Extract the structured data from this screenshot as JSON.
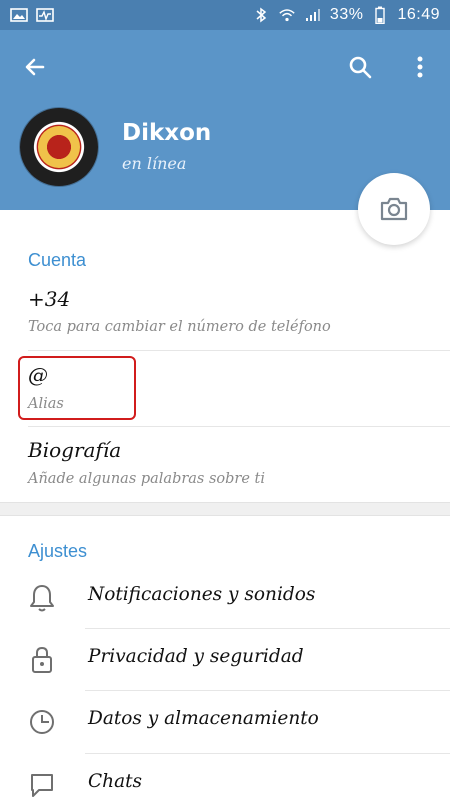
{
  "status_bar": {
    "battery_percent": "33%",
    "time": "16:49"
  },
  "profile": {
    "name": "Dikxon",
    "status": "en línea"
  },
  "account": {
    "section_title": "Cuenta",
    "phone_value": "+34",
    "phone_hint": "Toca para cambiar el número de teléfono",
    "username_value": "@",
    "username_hint": "Alias",
    "bio_value": "Biografía",
    "bio_hint": "Añade algunas palabras sobre ti"
  },
  "settings": {
    "section_title": "Ajustes",
    "items": [
      {
        "label": "Notificaciones y sonidos",
        "icon": "bell-icon"
      },
      {
        "label": "Privacidad y seguridad",
        "icon": "lock-icon"
      },
      {
        "label": "Datos y almacenamiento",
        "icon": "clock-icon"
      },
      {
        "label": "Chats",
        "icon": "chat-bubble-icon"
      }
    ]
  },
  "colors": {
    "header": "#5b95c8",
    "statusbar": "#4a7fb0",
    "accent": "#3d8fd1",
    "highlight": "#d11c1c"
  }
}
